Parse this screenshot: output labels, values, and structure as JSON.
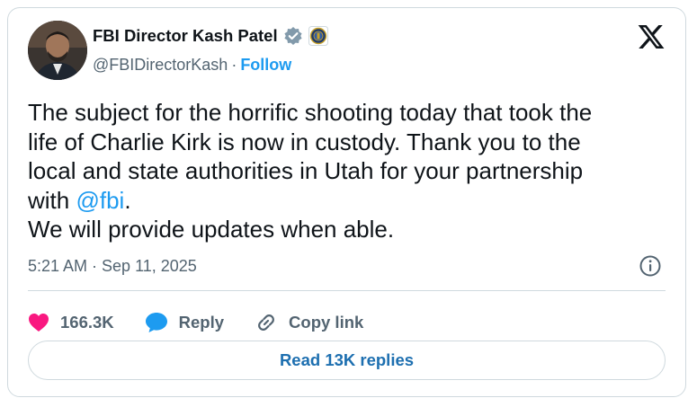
{
  "author": {
    "display_name": "FBI Director Kash Patel",
    "handle": "@FBIDirectorKash",
    "separator": "·",
    "follow_label": "Follow"
  },
  "tweet": {
    "text_line1": "The subject for the horrific shooting today that took the\nlife of Charlie Kirk is now in custody. Thank you to the\nlocal and state authorities in Utah for your partnership\nwith ",
    "mention": "@fbi",
    "text_line2": ".\nWe will provide updates when able.",
    "timestamp": "5:21 AM · Sep 11, 2025"
  },
  "actions": {
    "likes_count": "166.3K",
    "reply_label": "Reply",
    "copy_link_label": "Copy link"
  },
  "read_replies_label": "Read 13K replies",
  "colors": {
    "accent": "#1d9bf0",
    "like": "#f91880",
    "muted": "#536471",
    "border": "#cfd9de"
  },
  "icons": [
    "verified-badge-icon",
    "fbi-seal-icon",
    "x-logo-icon",
    "info-icon",
    "heart-icon",
    "reply-bubble-icon",
    "link-icon"
  ]
}
